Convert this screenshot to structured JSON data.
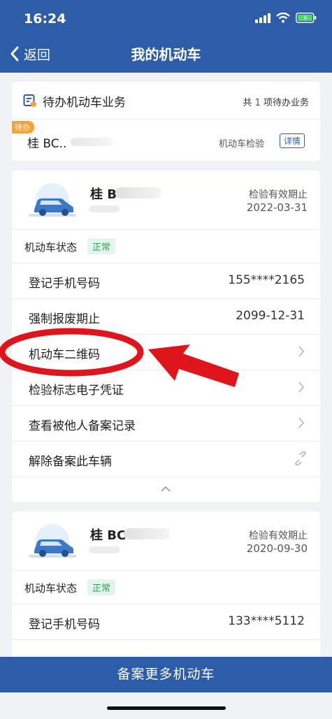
{
  "status_bar": {
    "time": "16:24"
  },
  "nav": {
    "back_label": "返回",
    "title": "我的机动车"
  },
  "pending": {
    "title": "待办机动车业务",
    "summary_prefix": "共",
    "summary_count": "1",
    "summary_suffix": "项待办业务",
    "badge": "待办",
    "plate": "桂 BC..",
    "business": "机动车检验",
    "detail_label": "详情"
  },
  "vehicles": [
    {
      "plate": "桂 B",
      "valid_label": "检验有效期止",
      "valid_date": "2022-03-31",
      "status_label": "机动车状态",
      "status_value": "正常",
      "rows": [
        {
          "label": "登记手机号码",
          "value": "155****2165"
        },
        {
          "label": "强制报废期止",
          "value": "2099-12-31"
        },
        {
          "label": "机动车二维码"
        },
        {
          "label": "检验标志电子凭证"
        },
        {
          "label": "查看被他人备案记录"
        },
        {
          "label": "解除备案此车辆"
        }
      ]
    },
    {
      "plate": "桂 BC",
      "valid_label": "检验有效期止",
      "valid_date": "2020-09-30",
      "status_label": "机动车状态",
      "status_value": "正常",
      "rows": [
        {
          "label": "登记手机号码",
          "value": "133****5112"
        }
      ]
    }
  ],
  "bottom_button": "备案更多机动车",
  "colors": {
    "primary": "#2d5da8",
    "annotation_red": "#e0141b",
    "ok_green": "#2aa55b",
    "badge_orange": "#f7a23b"
  }
}
